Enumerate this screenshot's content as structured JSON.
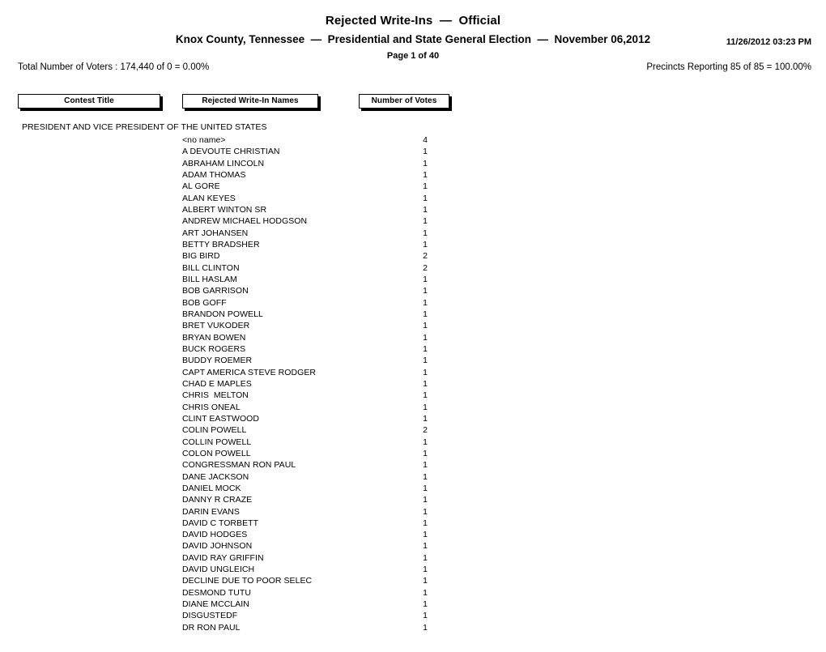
{
  "report": {
    "title_line_1": "Rejected Write-Ins  —  Official",
    "title_line_2": "Knox County, Tennessee  —  Presidential and State General Election  —  November 06,2012",
    "page_label": "Page 1 of 40",
    "timestamp": "11/26/2012 03:23 PM",
    "total_voters_line": "Total Number of Voters : 174,440 of 0 = 0.00%",
    "precincts_reporting_line": "Precincts Reporting 85 of 85 = 100.00%"
  },
  "column_headers": {
    "contest_title": "Contest Title",
    "rejected_names": "Rejected Write-In Names",
    "number_of_votes": "Number of Votes"
  },
  "contest": {
    "title": "PRESIDENT AND VICE PRESIDENT OF THE UNITED STATES"
  },
  "write_ins": [
    {
      "name": "<no name>",
      "votes": "4"
    },
    {
      "name": "A DEVOUTE CHRISTIAN",
      "votes": "1"
    },
    {
      "name": "ABRAHAM LINCOLN",
      "votes": "1"
    },
    {
      "name": "ADAM THOMAS",
      "votes": "1"
    },
    {
      "name": "AL GORE",
      "votes": "1"
    },
    {
      "name": "ALAN KEYES",
      "votes": "1"
    },
    {
      "name": "ALBERT WINTON SR",
      "votes": "1"
    },
    {
      "name": "ANDREW MICHAEL HODGSON",
      "votes": "1"
    },
    {
      "name": "ART JOHANSEN",
      "votes": "1"
    },
    {
      "name": "BETTY BRADSHER",
      "votes": "1"
    },
    {
      "name": "BIG BIRD",
      "votes": "2"
    },
    {
      "name": "BILL CLINTON",
      "votes": "2"
    },
    {
      "name": "BILL HASLAM",
      "votes": "1"
    },
    {
      "name": "BOB GARRISON",
      "votes": "1"
    },
    {
      "name": "BOB GOFF",
      "votes": "1"
    },
    {
      "name": "BRANDON POWELL",
      "votes": "1"
    },
    {
      "name": "BRET VUKODER",
      "votes": "1"
    },
    {
      "name": "BRYAN BOWEN",
      "votes": "1"
    },
    {
      "name": "BUCK ROGERS",
      "votes": "1"
    },
    {
      "name": "BUDDY ROEMER",
      "votes": "1"
    },
    {
      "name": "CAPT AMERICA STEVE RODGER",
      "votes": "1"
    },
    {
      "name": "CHAD E MAPLES",
      "votes": "1"
    },
    {
      "name": "CHRIS  MELTON",
      "votes": "1"
    },
    {
      "name": "CHRIS ONEAL",
      "votes": "1"
    },
    {
      "name": "CLINT EASTWOOD",
      "votes": "1"
    },
    {
      "name": "COLIN POWELL",
      "votes": "2"
    },
    {
      "name": "COLLIN POWELL",
      "votes": "1"
    },
    {
      "name": "COLON POWELL",
      "votes": "1"
    },
    {
      "name": "CONGRESSMAN RON PAUL",
      "votes": "1"
    },
    {
      "name": "DANE JACKSON",
      "votes": "1"
    },
    {
      "name": "DANIEL MOCK",
      "votes": "1"
    },
    {
      "name": "DANNY R CRAZE",
      "votes": "1"
    },
    {
      "name": "DARIN EVANS",
      "votes": "1"
    },
    {
      "name": "DAVID C TORBETT",
      "votes": "1"
    },
    {
      "name": "DAVID HODGES",
      "votes": "1"
    },
    {
      "name": "DAVID JOHNSON",
      "votes": "1"
    },
    {
      "name": "DAVID RAY GRIFFIN",
      "votes": "1"
    },
    {
      "name": "DAVID UNGLEICH",
      "votes": "1"
    },
    {
      "name": "DECLINE DUE TO POOR SELEC",
      "votes": "1"
    },
    {
      "name": "DESMOND TUTU",
      "votes": "1"
    },
    {
      "name": "DIANE MCCLAIN",
      "votes": "1"
    },
    {
      "name": "DISGUSTEDF",
      "votes": "1"
    },
    {
      "name": "DR RON PAUL",
      "votes": "1"
    }
  ]
}
